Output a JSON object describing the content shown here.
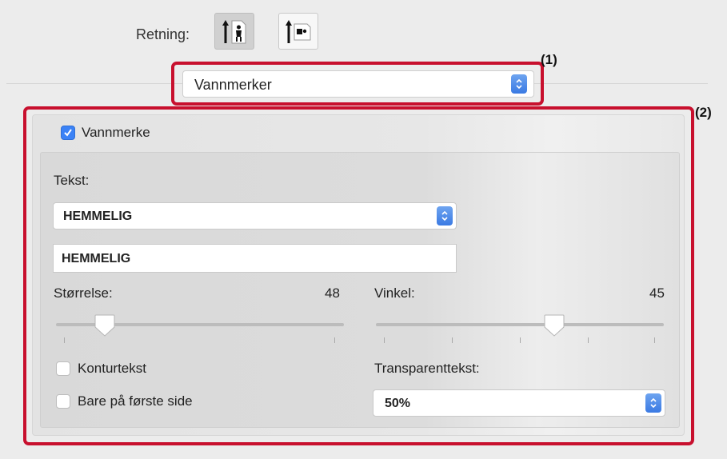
{
  "orientation": {
    "label": "Retning:",
    "options": [
      {
        "name": "portrait",
        "selected": true
      },
      {
        "name": "landscape",
        "selected": false
      }
    ]
  },
  "section_menu": {
    "selected": "Vannmerker",
    "marker": "(1)"
  },
  "watermark": {
    "marker": "(2)",
    "enable_label": "Vannmerke",
    "enabled": true,
    "text_label": "Tekst:",
    "text_select_value": "HEMMELIG",
    "text_field_value": "HEMMELIG",
    "size": {
      "label": "Størrelse:",
      "value": "48",
      "min": 0,
      "max": 400
    },
    "angle": {
      "label": "Vinkel:",
      "value": "45",
      "min": -90,
      "max": 90
    },
    "outline_label": "Konturtekst",
    "outline_checked": false,
    "first_page_label": "Bare på første side",
    "first_page_checked": false,
    "transparency_label": "Transparenttekst:",
    "transparency_value": "50%"
  },
  "colors": {
    "highlight": "#c8102e",
    "accent": "#3b82f6"
  }
}
